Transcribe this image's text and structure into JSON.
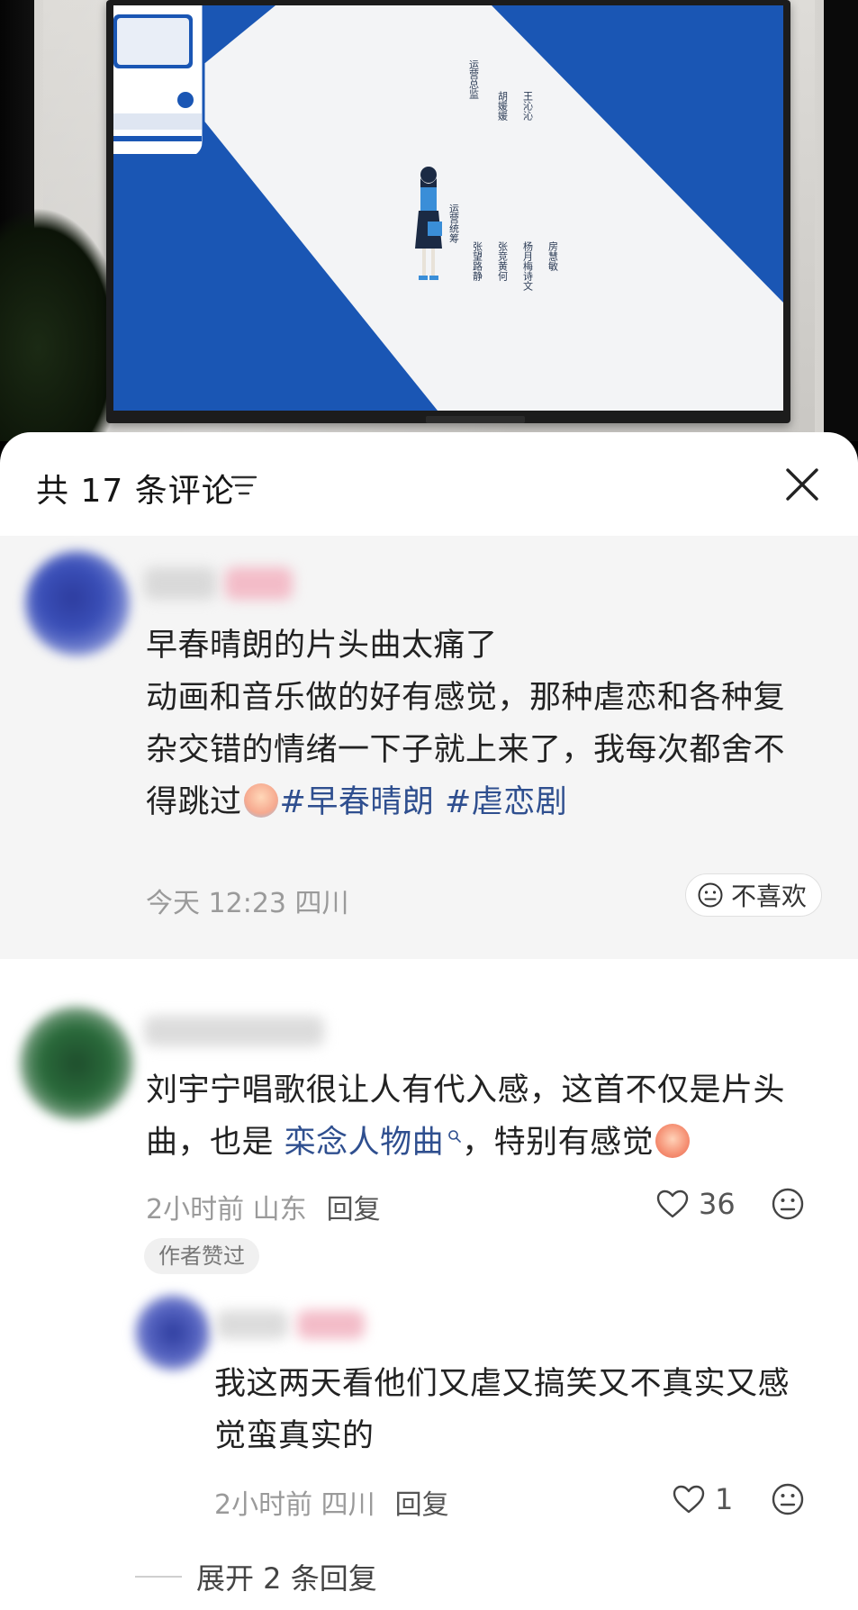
{
  "comments_header": {
    "title": "共 17 条评论",
    "sort_icon": "sort-lines-icon",
    "close_icon": "close-icon"
  },
  "pinned_comment": {
    "lines": [
      "早春晴朗的片头曲太痛了",
      "动画和音乐做的好有感觉，那种虐恋和各种复",
      "杂交错的情绪一下子就上来了，我每次都舍不"
    ],
    "last_line_prefix": "得跳过",
    "hashtags": [
      "#早春晴朗",
      "#虐恋剧"
    ],
    "time_location": "今天 12:23 四川",
    "dislike_label": "不喜欢"
  },
  "comment_2": {
    "line1": "刘宇宁唱歌很让人有代入感，这首不仅是片头",
    "line2_prefix": "曲，也是",
    "link_text": "栾念人物曲",
    "line2_suffix": "，特别有感觉",
    "time_location": "2小时前 山东",
    "reply_label": "回复",
    "likes": "36",
    "author_badge": "作者赞过"
  },
  "reply_1": {
    "line1": "我这两天看他们又虐又搞笑又不真实又感",
    "line2": "觉蛮真实的",
    "time_location": "2小时前 四川",
    "reply_label": "回复",
    "likes": "1"
  },
  "expand_replies": "展开 2 条回复",
  "tv_credits": {
    "col_a_title": "运营总监",
    "col_a": [
      "胡媛媛",
      "王沁沁"
    ],
    "col_b_title": "运营统筹",
    "col_b": [
      "张望路静",
      "张竞黄何",
      "杨月梅诗文",
      "房慧敏"
    ]
  },
  "colors": {
    "tv_blue": "#1a56b4",
    "hashtag": "#2f4f8f",
    "pinned_bg": "#f5f5f5"
  }
}
